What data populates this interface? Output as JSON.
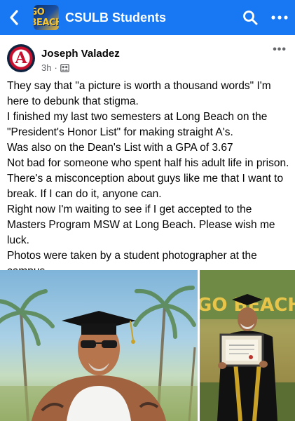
{
  "topbar": {
    "group_logo_text": "GO BEACH",
    "group_name": "CSULB Students",
    "back_icon": "chevron-left-icon",
    "search_icon": "search-icon",
    "more_icon": "more-horizontal-icon",
    "accent_color": "#1877f2"
  },
  "post": {
    "author": "Joseph Valadez",
    "avatar_letter": "A",
    "time": "3h",
    "separator": "·",
    "audience_icon": "group-audience-icon",
    "more_label": "•••",
    "paragraphs": [
      "They say that \"a picture is worth a thousand words\" I'm here to debunk that stigma.",
      "I finished my last two semesters at Long Beach on the \"President's Honor List\" for making straight A's.",
      "Was also on the Dean's List with a GPA of 3.67",
      "Not bad for someone who spent half his adult life in prison.",
      "There's a misconception about guys like me that I want to break. If I can do it, anyone can.",
      "Right now I'm waiting to see if I get accepted to the Masters Program MSW at Long Beach. Please wish me luck.",
      "Photos were taken by a student photographer at the campus."
    ]
  },
  "photos": {
    "right_sign_text": "GO BEACH"
  }
}
